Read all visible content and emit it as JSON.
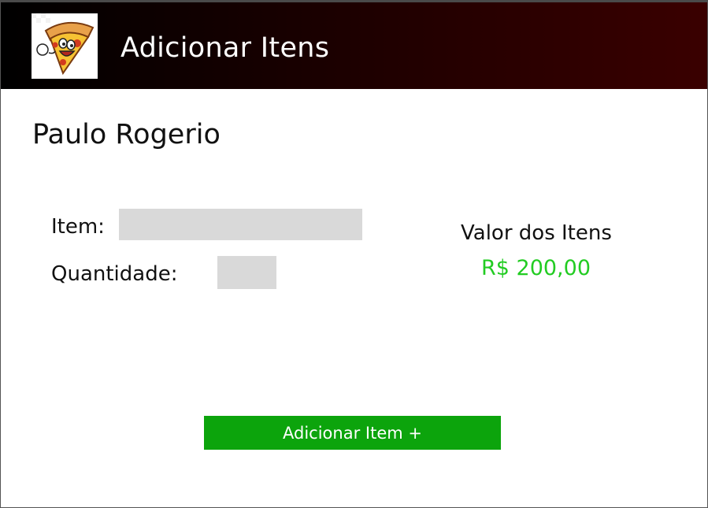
{
  "header": {
    "title": "Adicionar Itens",
    "logo_icon": "pizza-mascot-icon",
    "gradient_colors": [
      "#000000",
      "#3a0000"
    ]
  },
  "customer": {
    "name": "Paulo Rogerio"
  },
  "form": {
    "item_label": "Item:",
    "item_value": "",
    "quantity_label": "Quantidade:",
    "quantity_value": ""
  },
  "summary": {
    "label": "Valor dos Itens",
    "value": "R$ 200,00",
    "value_color": "#22cc22"
  },
  "actions": {
    "add_item_label": "Adicionar Item +",
    "button_color": "#0ca40c"
  }
}
